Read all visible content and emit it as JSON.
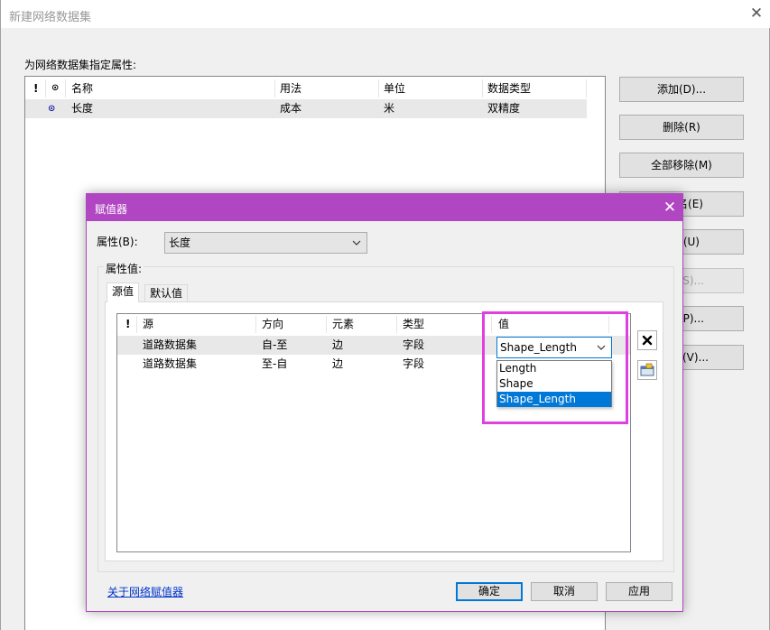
{
  "main_window": {
    "title": "新建网络数据集",
    "close_glyph": "✕",
    "attributes_label": "为网络数据集指定属性:",
    "table": {
      "header_icon1": "!",
      "header_icon2": "⊙",
      "columns": [
        "名称",
        "用法",
        "单位",
        "数据类型"
      ],
      "rows": [
        {
          "icon": "⊙",
          "values": [
            "长度",
            "成本",
            "米",
            "双精度"
          ]
        }
      ]
    },
    "side_buttons": [
      {
        "label": "添加(D)...",
        "enabled": true
      },
      {
        "label": "删除(R)",
        "enabled": true
      },
      {
        "label": "全部移除(M)",
        "enabled": true
      },
      {
        "label": "名(E)",
        "enabled": true
      },
      {
        "label": "(U)",
        "enabled": true
      },
      {
        "label": "S)...",
        "enabled": false
      },
      {
        "label": "(P)...",
        "enabled": true
      },
      {
        "label": "(V)...",
        "enabled": true
      }
    ]
  },
  "dialog": {
    "title": "赋值器",
    "close_glyph": "✕",
    "property_label": "属性(B):",
    "property_value": "长度",
    "group_title": "属性值:",
    "tabs": [
      {
        "label": "源值",
        "active": true
      },
      {
        "label": "默认值",
        "active": false
      }
    ],
    "grid": {
      "header_icon": "!",
      "columns": [
        "源",
        "方向",
        "元素",
        "类型",
        "值"
      ],
      "rows": [
        {
          "values": [
            "道路数据集",
            "自-至",
            "边",
            "字段"
          ],
          "selected": true
        },
        {
          "values": [
            "道路数据集",
            "至-自",
            "边",
            "字段"
          ],
          "selected": false
        }
      ]
    },
    "value_combo": {
      "current": "Shape_Length",
      "options": [
        {
          "label": "Length",
          "selected": false
        },
        {
          "label": "Shape",
          "selected": false
        },
        {
          "label": "Shape_Length",
          "selected": true
        }
      ]
    },
    "link_text": "关于网络赋值器",
    "buttons": {
      "ok": "确定",
      "cancel": "取消",
      "apply": "应用"
    }
  },
  "colors": {
    "dialog_accent": "#b146c2",
    "highlight": "#e040e0",
    "selection": "#0078d7"
  }
}
